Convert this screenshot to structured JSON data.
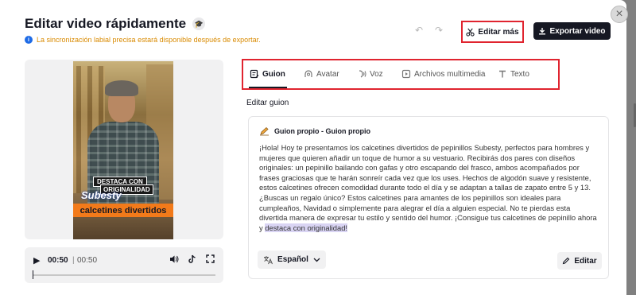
{
  "dialog": {
    "title": "Editar video rápidamente",
    "notice": "La sincronización labial precisa estará disponible después de exportar.",
    "close_label": "×"
  },
  "toolbar": {
    "undo_label": "↶",
    "redo_label": "↷",
    "edit_more_label": "Editar más",
    "export_label": "Exportar video"
  },
  "video": {
    "overlay_line1": "DESTACA CON",
    "overlay_line2": "ORIGINALIDAD",
    "brand": "Subesty",
    "caption": "calcetines divertidos"
  },
  "player": {
    "current_time": "00:50",
    "separator": "|",
    "total_time": "00:50",
    "progress_fraction": 0.0
  },
  "tabs": [
    {
      "label": "Guion",
      "icon": "script-icon",
      "active": true
    },
    {
      "label": "Avatar",
      "icon": "avatar-icon",
      "active": false
    },
    {
      "label": "Voz",
      "icon": "voice-icon",
      "active": false
    },
    {
      "label": "Archivos multimedia",
      "icon": "media-icon",
      "active": false
    },
    {
      "label": "Texto",
      "icon": "text-icon",
      "active": false
    }
  ],
  "script": {
    "section_label": "Editar guion",
    "card_title": "Guion propio - Guion propio",
    "body_main": "¡Hola! Hoy te presentamos los calcetines divertidos de pepinillos Subesty, perfectos para hombres y mujeres que quieren añadir un toque de humor a su vestuario. Recibirás dos pares con diseños originales: un pepinillo bailando con gafas y otro escapando del frasco, ambos acompañados por frases graciosas que te harán sonreír cada vez que los uses. Hechos de algodón suave y resistente, estos calcetines ofrecen comodidad durante todo el día y se adaptan a tallas de zapato entre 5 y 13. ¿Buscas un regalo único? Estos calcetines para amantes de los pepinillos son ideales para cumpleaños, Navidad o simplemente para alegrar el día a alguien especial. No te pierdas esta divertida manera de expresar tu estilo y sentido del humor. ¡Consigue tus calcetines de pepinillo ahora y ",
    "body_highlight": "destaca con originalidad!",
    "language_label": "Español",
    "edit_label": "Editar"
  },
  "colors": {
    "highlight_border": "#e0242f",
    "notice_text": "#d98a00",
    "export_bg": "#161823",
    "caption_bg": "#f27a1a",
    "text_highlight": "#d9d4f3"
  }
}
